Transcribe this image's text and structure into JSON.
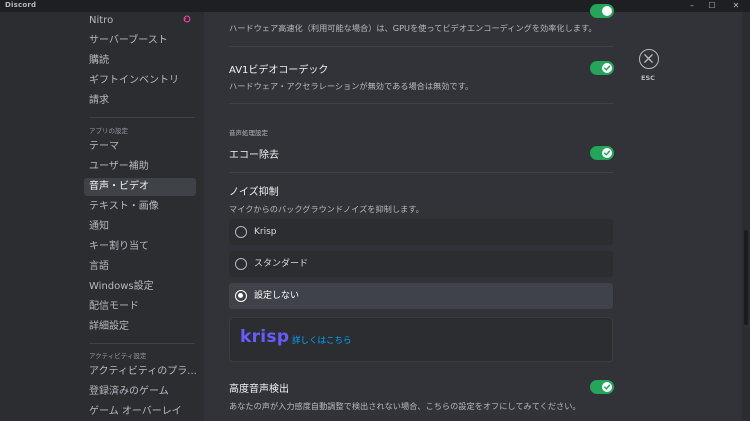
{
  "window": {
    "title": "Discord",
    "controls": {
      "minimize": "–",
      "maximize": "☐",
      "close": "✕"
    }
  },
  "sidebar": {
    "items_top": [
      {
        "label": "Nitro"
      },
      {
        "label": "サーバーブースト"
      },
      {
        "label": "購読"
      },
      {
        "label": "ギフトインベントリ"
      },
      {
        "label": "請求"
      }
    ],
    "app_settings_header": "アプリの設定",
    "app_items": [
      {
        "label": "テーマ"
      },
      {
        "label": "ユーザー補助"
      },
      {
        "label": "音声・ビデオ",
        "active": true
      },
      {
        "label": "テキスト・画像"
      },
      {
        "label": "通知"
      },
      {
        "label": "キー割り当て"
      },
      {
        "label": "言語"
      },
      {
        "label": "Windows設定"
      },
      {
        "label": "配信モード"
      },
      {
        "label": "詳細設定"
      }
    ],
    "activity_header": "アクティビティ設定",
    "activity_items": [
      {
        "label": "アクティビティのプラ..."
      },
      {
        "label": "登録済みのゲーム"
      },
      {
        "label": "ゲーム オーバーレイ"
      }
    ],
    "nitro_icon": "nitro-icon"
  },
  "main": {
    "hw_accel_desc": "ハードウェア高速化（利用可能な場合）は、GPUを使ってビデオエンコーディングを効率化します。",
    "hw_accel_enabled": true,
    "av1": {
      "title": "AV1ビデオコーデック",
      "desc": "ハードウェア・アクセラレーションが無効である場合は無効です。",
      "enabled": true
    },
    "audio_section_header": "音声処理設定",
    "echo": {
      "title": "エコー除去",
      "enabled": true
    },
    "noise": {
      "title": "ノイズ抑制",
      "desc": "マイクからのバックグラウンドノイズを抑制します。",
      "options": [
        {
          "label": "Krisp",
          "selected": false
        },
        {
          "label": "スタンダード",
          "selected": false
        },
        {
          "label": "設定しない",
          "selected": true
        }
      ]
    },
    "krisp_card": {
      "logo": "krisp",
      "link": "詳しくはこちら"
    },
    "advanced_vad": {
      "title": "高度音声検出",
      "desc": "あなたの声が入力感度自動調整で検出されない場合、こちらの設定をオフにしてみてください。",
      "enabled": true
    }
  },
  "esc": {
    "label": "ESC",
    "icon": "close-icon"
  },
  "colors": {
    "background": "#313338",
    "sidebar": "#2b2d31",
    "toggle_on": "#23a55a",
    "link": "#00a8fc",
    "krisp": "#6b5bff",
    "nitro": "#eb459f"
  }
}
